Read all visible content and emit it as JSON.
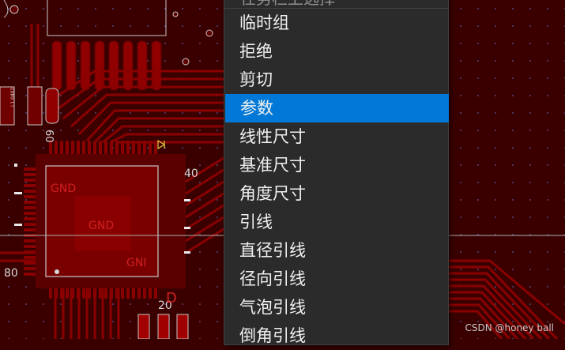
{
  "pcb": {
    "labels": {
      "gnd_1": "GND",
      "gnd_2": "GND",
      "gnd_3": "GNI",
      "pin_40": "40",
      "pin_20": "20",
      "pin_80": "80",
      "pin_60": "60",
      "part_ref": "D",
      "smd_label": "L1 0402"
    },
    "colors": {
      "board": "#3a0000",
      "copper": "#8b0000",
      "trace": "#a00000",
      "silk": "#d8d8d8",
      "text_red": "#d02020"
    }
  },
  "context_menu": {
    "header_fragment": "任务栏上选择",
    "items": [
      {
        "label": "临时组",
        "selected": false
      },
      {
        "label": "拒绝",
        "selected": false
      },
      {
        "label": "剪切",
        "selected": false
      },
      {
        "label": "参数",
        "selected": true
      },
      {
        "label": "线性尺寸",
        "selected": false
      },
      {
        "label": "基准尺寸",
        "selected": false
      },
      {
        "label": "角度尺寸",
        "selected": false
      },
      {
        "label": "引线",
        "selected": false
      },
      {
        "label": "直径引线",
        "selected": false
      },
      {
        "label": "径向引线",
        "selected": false
      },
      {
        "label": "气泡引线",
        "selected": false
      },
      {
        "label": "倒角引线",
        "selected": false
      }
    ],
    "selected_color": "#0078d7",
    "bg_color": "#2b2b2b"
  },
  "watermark": "CSDN @honey ball"
}
